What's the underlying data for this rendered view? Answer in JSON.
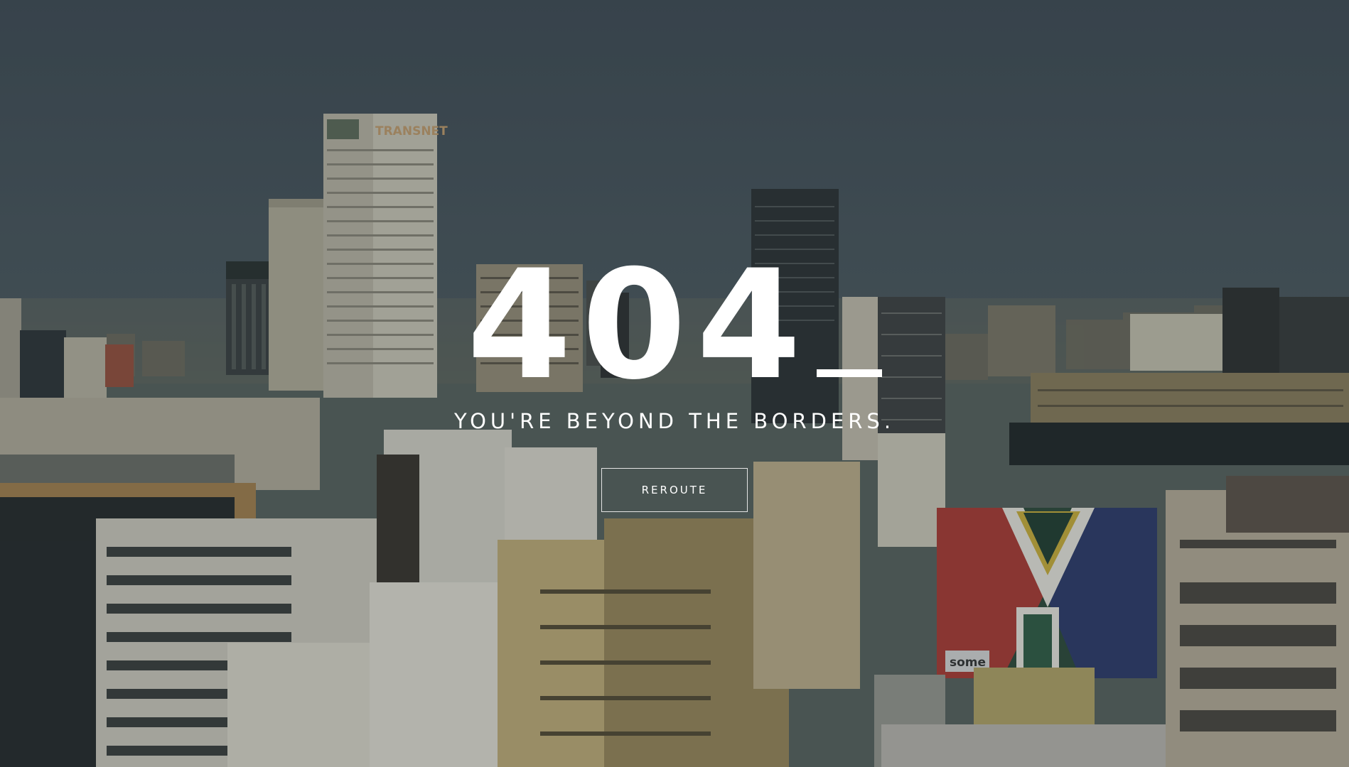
{
  "error": {
    "code": "404",
    "cursor": "_",
    "message": "YOU'RE BEYOND THE BORDERS."
  },
  "actions": {
    "reroute_label": "REROUTE"
  },
  "background": {
    "signage": {
      "transnet": "TRANSNET",
      "flag_sign": "some"
    }
  }
}
